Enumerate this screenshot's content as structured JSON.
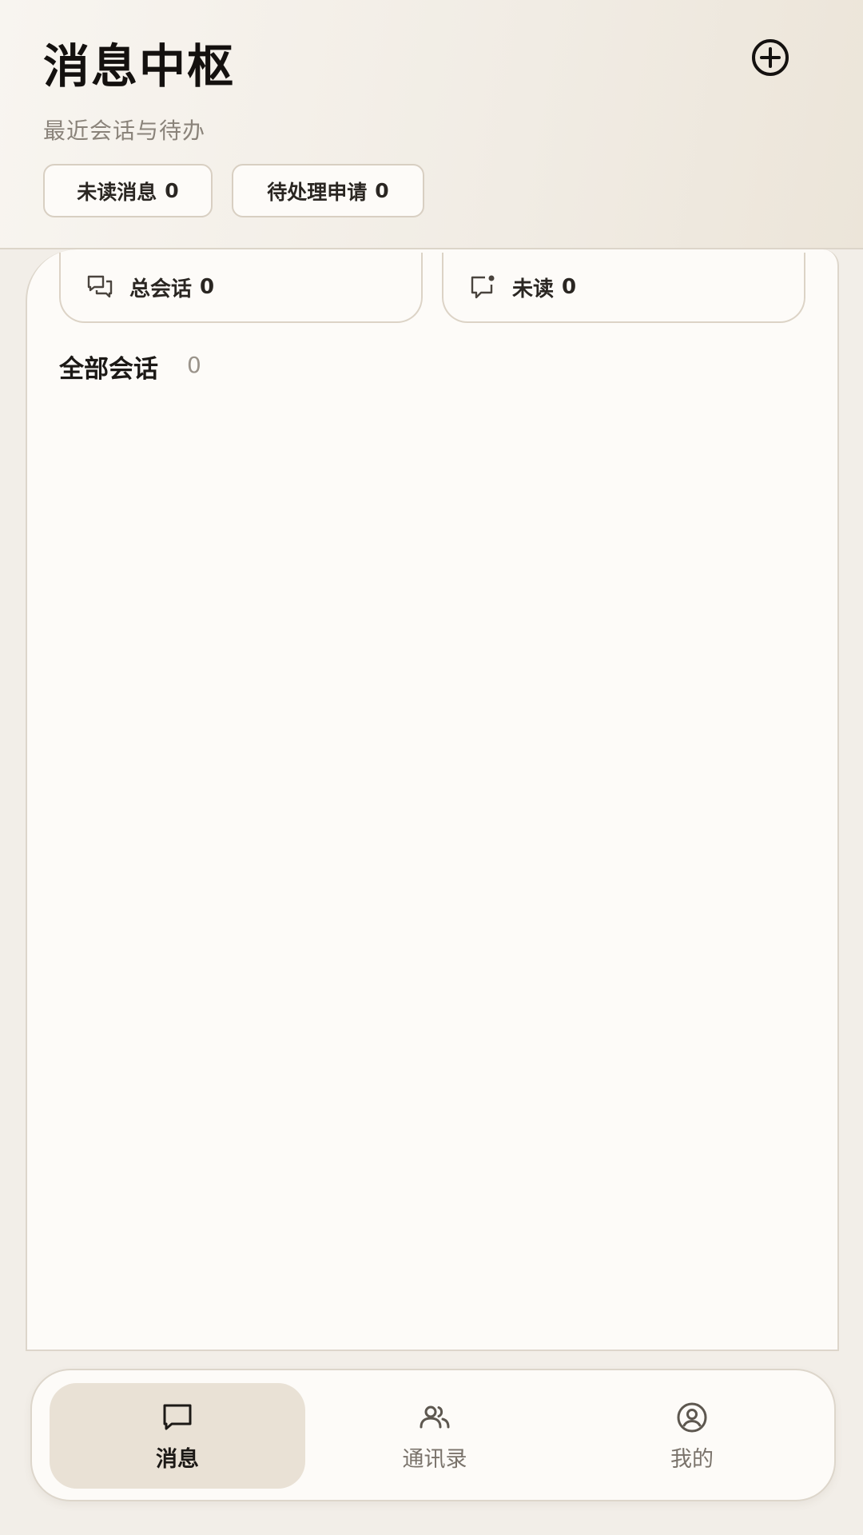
{
  "header": {
    "title": "消息中枢",
    "subtitle": "最近会话与待办",
    "add_icon": "plus-circle-icon",
    "chips": [
      {
        "label": "未读消息",
        "count": "0"
      },
      {
        "label": "待处理申请",
        "count": "0"
      }
    ]
  },
  "stats": [
    {
      "icon": "chat-bubbles-icon",
      "label": "总会话",
      "count": "0"
    },
    {
      "icon": "chat-unread-icon",
      "label": "未读",
      "count": "0"
    }
  ],
  "section": {
    "title": "全部会话",
    "count": "0"
  },
  "tabbar": {
    "active": 0,
    "tabs": [
      {
        "label": "消息",
        "icon": "message-icon"
      },
      {
        "label": "通讯录",
        "icon": "contacts-icon"
      },
      {
        "label": "我的",
        "icon": "profile-icon"
      }
    ]
  },
  "colors": {
    "background": "#f2eee8",
    "panel": "#fdfbf8",
    "active_tab": "#e9e1d5",
    "border": "#ddd6cb",
    "text_primary": "#1c1916",
    "text_secondary": "#8a837a"
  }
}
